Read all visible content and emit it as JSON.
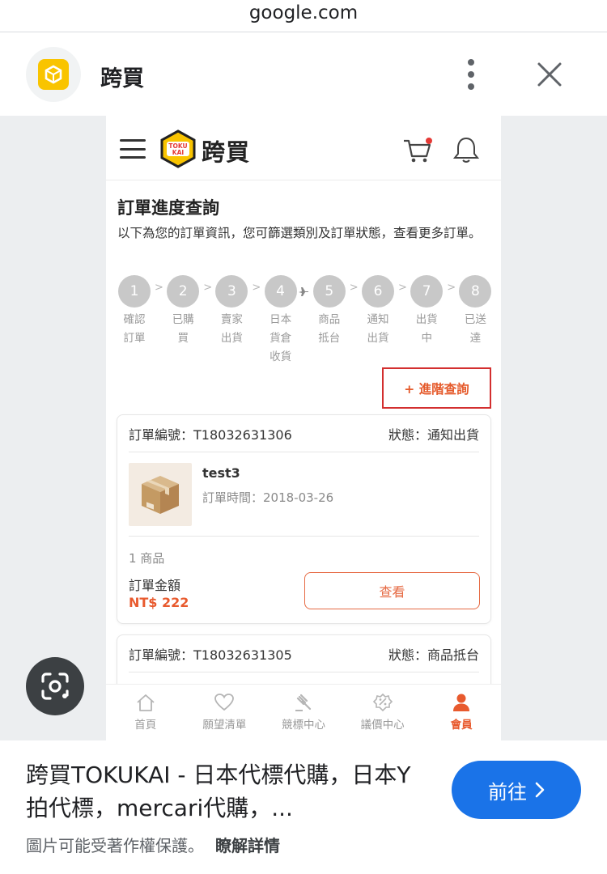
{
  "browser": {
    "domain": "google.com"
  },
  "site": {
    "name": "跨買"
  },
  "app": {
    "brand_text": "跨買",
    "logo_lines": [
      "TOKU",
      "KAI"
    ],
    "page_title": "訂單進度查詢",
    "page_desc": "以下為您的訂單資訊，您可篩選類別及訂單狀態，查看更多訂單。",
    "steps": [
      {
        "num": "1",
        "label": "確認\n訂單"
      },
      {
        "num": "2",
        "label": "已購\n買"
      },
      {
        "num": "3",
        "label": "賣家\n出貨"
      },
      {
        "num": "4",
        "label": "日本\n貨倉\n收貨"
      },
      {
        "num": "5",
        "label": "商品\n抵台"
      },
      {
        "num": "6",
        "label": "通知\n出貨"
      },
      {
        "num": "7",
        "label": "出貨\n中"
      },
      {
        "num": "8",
        "label": "已送\n達"
      }
    ],
    "arrow_glyph": ">",
    "advanced_search": "+ 進階查詢",
    "orders": [
      {
        "number": "訂單編號：T18032631306",
        "status": "狀態：通知出貨",
        "product_name": "test3",
        "order_time": "訂單時間：2018-03-26",
        "item_count": "1 商品",
        "amount_label": "訂單金額",
        "amount": "NT$ 222",
        "view_label": "查看"
      },
      {
        "number": "訂單編號：T18032631305",
        "status": "狀態：商品抵台"
      }
    ],
    "bottom_nav": [
      {
        "label": "首頁",
        "icon": "home-icon"
      },
      {
        "label": "願望清單",
        "icon": "heart-icon"
      },
      {
        "label": "競標中心",
        "icon": "gavel-icon"
      },
      {
        "label": "議價中心",
        "icon": "discount-tag-icon"
      },
      {
        "label": "會員",
        "icon": "user-icon",
        "active": true
      }
    ]
  },
  "result": {
    "title": "跨買TOKUKAI - 日本代標代購，日本Y拍代標，mercari代購，...",
    "visit_label": "前往",
    "copyright_notice": "圖片可能受著作權保護。",
    "learn_more": "瞭解詳情"
  },
  "colors": {
    "accent": "#e85a2e",
    "google_blue": "#1a73e8",
    "brand_yellow": "#f9c400",
    "step_gray": "#c8c8c8"
  }
}
